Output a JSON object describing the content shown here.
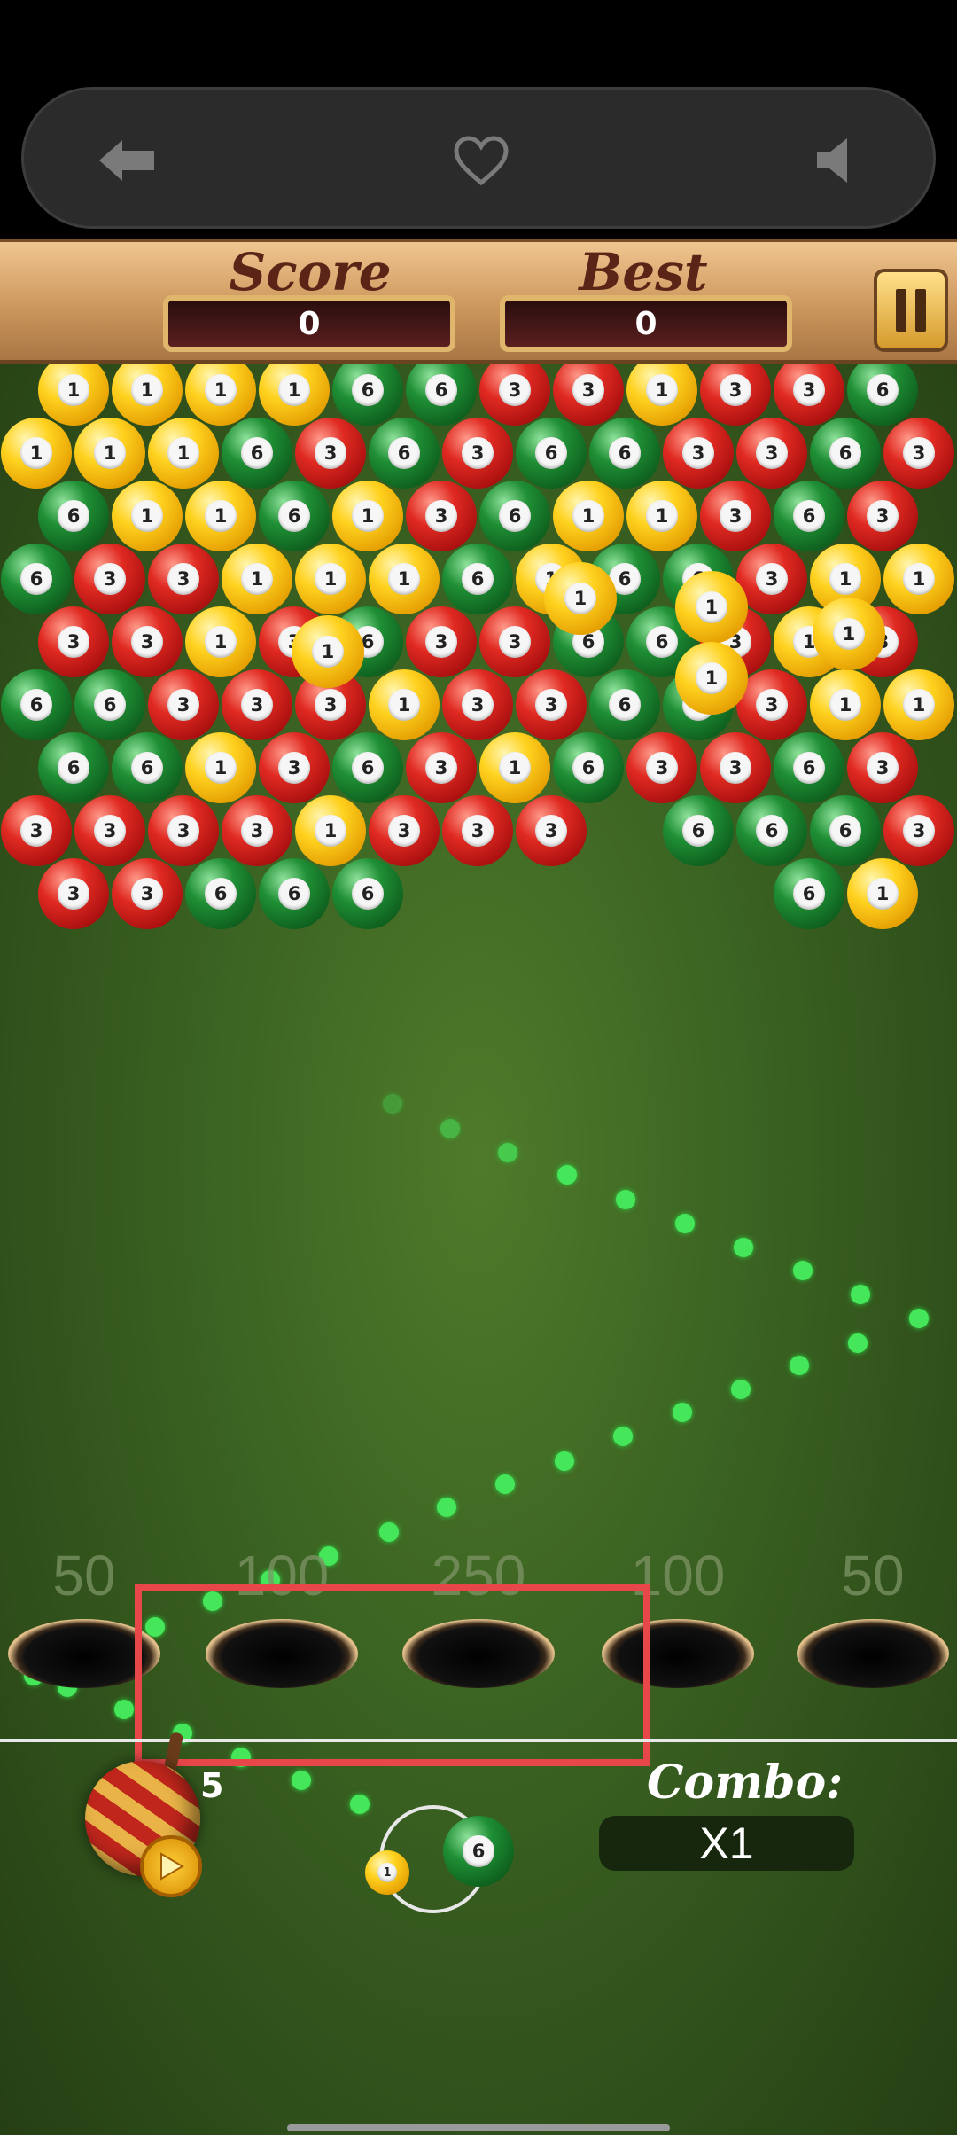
{
  "nav": {
    "back_icon": "back-arrow-icon",
    "favorite_icon": "heart-icon",
    "sound_icon": "speaker-icon"
  },
  "header": {
    "score_label": "Score",
    "score_value": "0",
    "best_label": "Best",
    "best_value": "0",
    "pause_icon": "pause-icon"
  },
  "bubble_rows": [
    [
      "1",
      "1",
      "1",
      "1",
      "6",
      "6",
      "3",
      "3",
      "1",
      "3",
      "3",
      "6"
    ],
    [
      "1",
      "1",
      "1",
      "6",
      "3",
      "6",
      "3",
      "6",
      "6",
      "3",
      "3",
      "6",
      "3"
    ],
    [
      "6",
      "1",
      "1",
      "6",
      "1",
      "3",
      "6",
      "1",
      "1",
      "3",
      "6",
      "3"
    ],
    [
      "6",
      "3",
      "3",
      "1",
      "1",
      "1",
      "6",
      "1",
      "6",
      "6",
      "3",
      "1",
      "1"
    ],
    [
      "3",
      "3",
      "1",
      "3",
      "6",
      "3",
      "3",
      "6",
      "6",
      "3",
      "1",
      "3"
    ],
    [
      "6",
      "6",
      "3",
      "3",
      "3",
      "1",
      "3",
      "3",
      "6",
      "6",
      "3",
      "1",
      "1"
    ],
    [
      "6",
      "6",
      "1",
      "3",
      "6",
      "3",
      "1",
      "6",
      "3",
      "3",
      "6",
      "3"
    ],
    [
      "3",
      "3",
      "3",
      "3",
      "1",
      "3",
      "3",
      "3",
      "",
      "6",
      "6",
      "6",
      "3"
    ],
    [
      "3",
      "3",
      "6",
      "6",
      "6",
      "",
      "",
      "",
      "",
      "",
      "6",
      "1"
    ]
  ],
  "floating_bubbles": [
    "1",
    "1",
    "1",
    "1",
    "1"
  ],
  "pocket_points": [
    "50",
    "100",
    "250",
    "100",
    "50"
  ],
  "bomb": {
    "count": "5",
    "play_icon": "play-icon"
  },
  "shooter": {
    "current": "6",
    "next": "1"
  },
  "combo": {
    "label": "Combo:",
    "value": "X1"
  },
  "colors": {
    "ball_1": "#ffd21f",
    "ball_3": "#e02a22",
    "ball_6": "#1f8f35",
    "aim_dots": "#45e65a",
    "highlight": "#e8474a"
  }
}
